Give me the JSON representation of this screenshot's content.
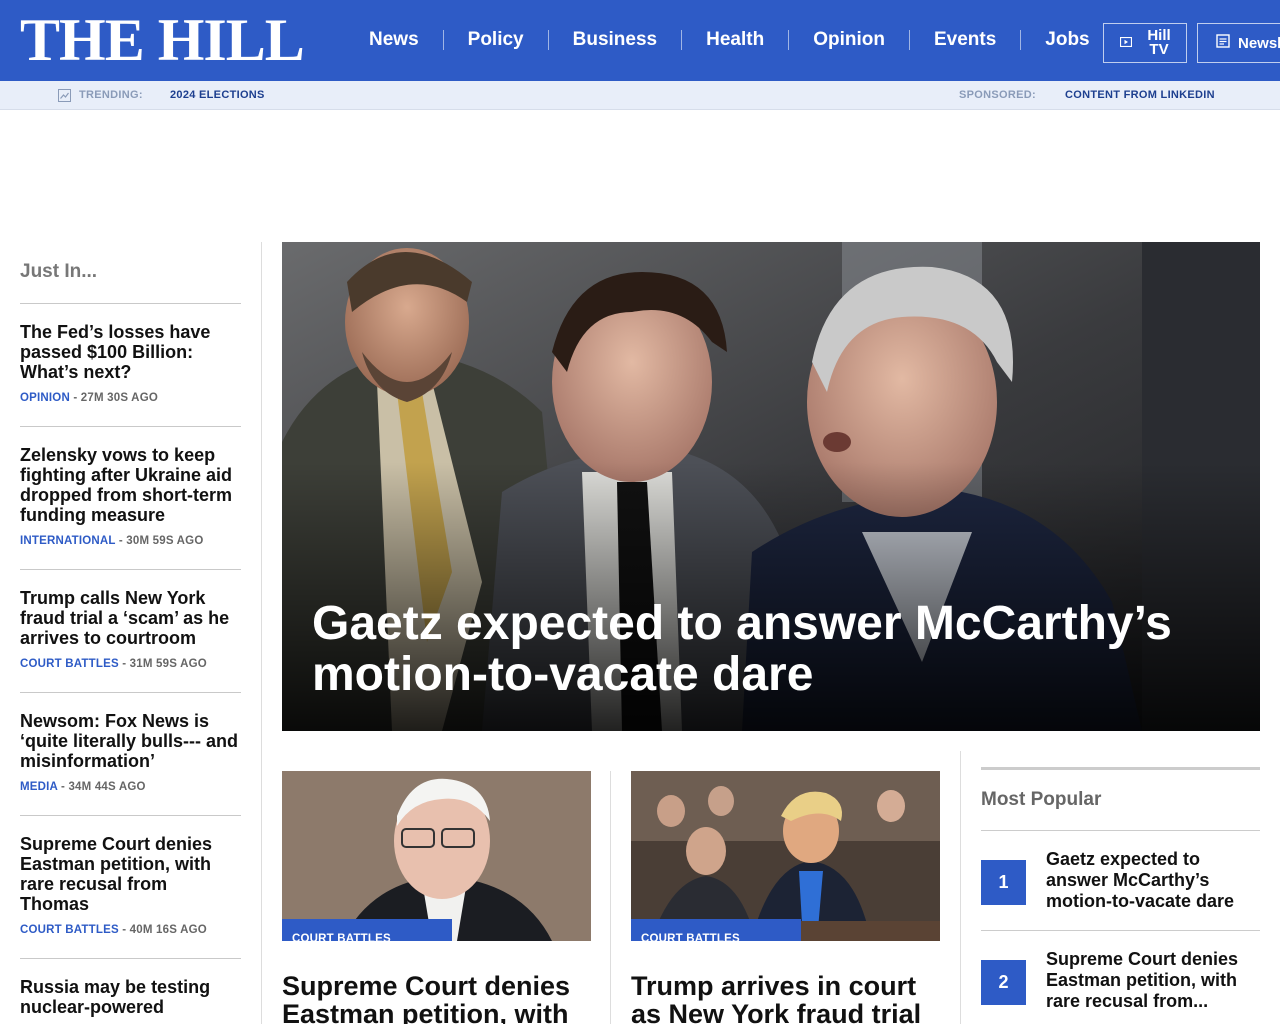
{
  "header": {
    "logo": "THE HILL",
    "nav": [
      "News",
      "Policy",
      "Business",
      "Health",
      "Opinion",
      "Events",
      "Jobs"
    ],
    "hill_tv_label": "Hill TV",
    "newsletters_label": "Newsletters",
    "brand_color": "#2e5bc6"
  },
  "trending": {
    "label": "TRENDING:",
    "link": "2024 ELECTIONS",
    "sponsored_label": "SPONSORED:",
    "sponsored_link": "CONTENT FROM LINKEDIN"
  },
  "just_in": {
    "title": "Just In...",
    "items": [
      {
        "headline": "The Fed’s losses have passed $100 Billion: What’s next?",
        "category": "OPINION",
        "time": " - 27M 30S AGO"
      },
      {
        "headline": "Zelensky vows to keep fighting after Ukraine aid dropped from short-term funding measure",
        "category": "INTERNATIONAL",
        "time": " - 30M 59S AGO"
      },
      {
        "headline": "Trump calls New York fraud trial a ‘scam’ as he arrives to courtroom",
        "category": "COURT BATTLES",
        "time": " - 31M 59S AGO"
      },
      {
        "headline": "Newsom: Fox News is ‘quite literally bulls--- and misinformation’",
        "category": "MEDIA",
        "time": " - 34M 44S AGO"
      },
      {
        "headline": "Supreme Court denies Eastman petition, with rare recusal from Thomas",
        "category": "COURT BATTLES",
        "time": " - 40M 16S AGO"
      },
      {
        "headline": "Russia may be testing nuclear-powered",
        "category": "",
        "time": ""
      }
    ]
  },
  "hero": {
    "headline": "Gaetz expected to answer McCarthy’s motion-to-vacate dare"
  },
  "cards": [
    {
      "tag": "COURT BATTLES",
      "headline": "Supreme Court denies Eastman petition, with"
    },
    {
      "tag": "COURT BATTLES",
      "headline": "Trump arrives in court as New York fraud trial"
    }
  ],
  "most_popular": {
    "title": "Most Popular",
    "items": [
      {
        "rank": "1",
        "headline": "Gaetz expected to answer McCarthy’s motion-to-vacate dare"
      },
      {
        "rank": "2",
        "headline": "Supreme Court denies Eastman petition, with rare recusal from..."
      }
    ]
  }
}
